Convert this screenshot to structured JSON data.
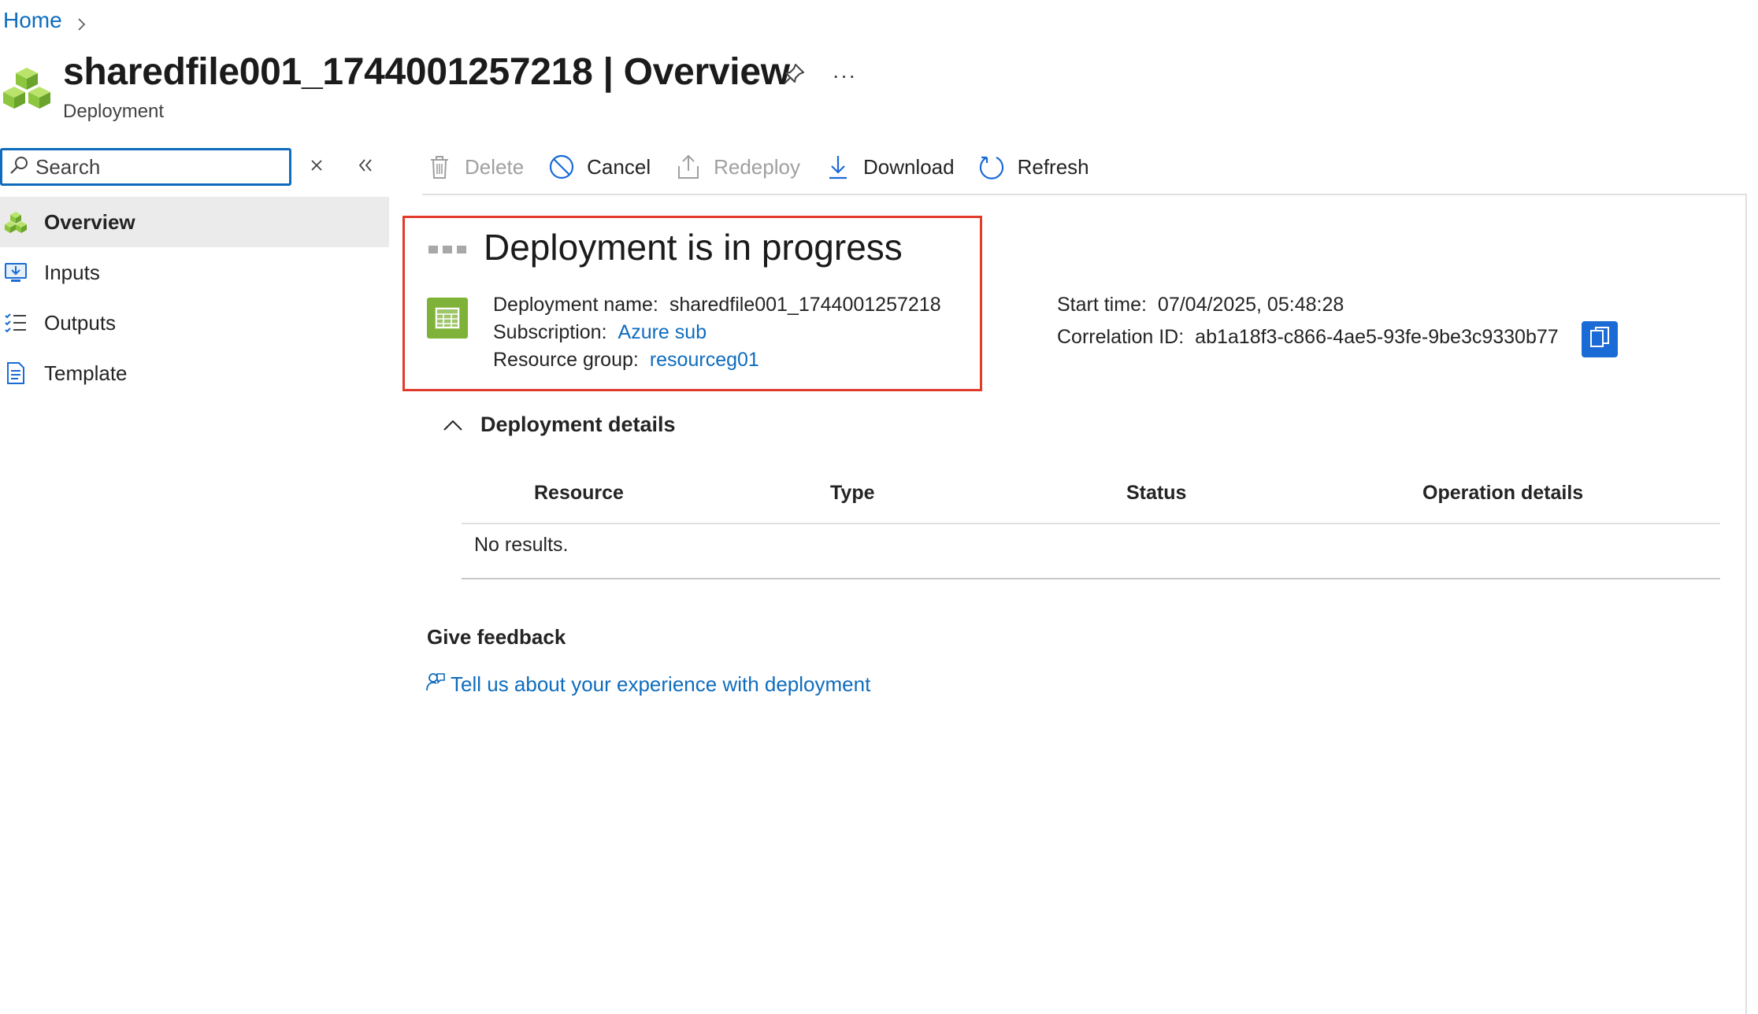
{
  "breadcrumb": {
    "home": "Home"
  },
  "header": {
    "title": "sharedfile001_1744001257218 | Overview",
    "subtitle": "Deployment",
    "more": "···"
  },
  "sidebar": {
    "search_placeholder": "Search",
    "items": [
      {
        "label": "Overview",
        "icon": "deployment-cubes-icon",
        "active": true
      },
      {
        "label": "Inputs",
        "icon": "inputs-icon",
        "active": false
      },
      {
        "label": "Outputs",
        "icon": "outputs-list-icon",
        "active": false
      },
      {
        "label": "Template",
        "icon": "document-icon",
        "active": false
      }
    ]
  },
  "toolbar": {
    "delete": "Delete",
    "cancel": "Cancel",
    "redeploy": "Redeploy",
    "download": "Download",
    "refresh": "Refresh"
  },
  "status": {
    "title": "Deployment is in progress",
    "deployment_name_label": "Deployment name:",
    "deployment_name": "sharedfile001_1744001257218",
    "subscription_label": "Subscription:",
    "subscription": "Azure sub",
    "resource_group_label": "Resource group:",
    "resource_group": "resourceg01",
    "start_time_label": "Start time:",
    "start_time": "07/04/2025, 05:48:28",
    "correlation_id_label": "Correlation ID:",
    "correlation_id": "ab1a18f3-c866-4ae5-93fe-9be3c9330b77"
  },
  "details": {
    "title": "Deployment details",
    "columns": [
      "Resource",
      "Type",
      "Status",
      "Operation details"
    ],
    "empty_text": "No results."
  },
  "feedback": {
    "title": "Give feedback",
    "link": "Tell us about your experience with deployment"
  },
  "colors": {
    "accent": "#0f6cbd",
    "highlight_border": "#e23b2c",
    "deployment_green": "#7fb238",
    "copy_button": "#1a6bd6"
  }
}
